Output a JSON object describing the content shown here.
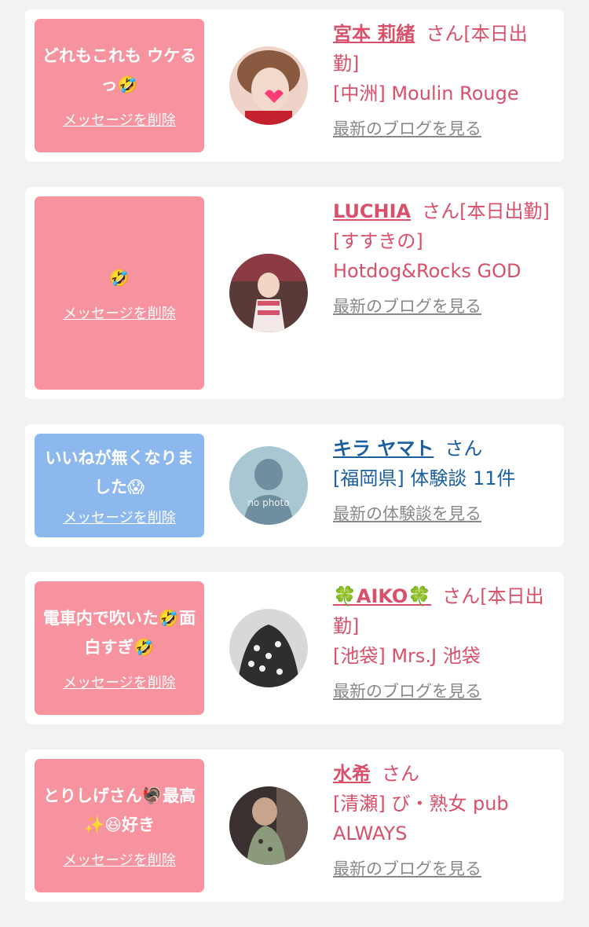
{
  "entries": [
    {
      "message": "どれもこれも ウケるっ🤣",
      "delete_label": "メッセージを削除",
      "name": "宮本 莉緒",
      "suffix": "さん[本日出勤]",
      "detail": "[中洲] Moulin Rouge",
      "link": "最新のブログを見る",
      "theme": "pink"
    },
    {
      "message": "🤣",
      "delete_label": "メッセージを削除",
      "name": "LUCHIA",
      "suffix": "さん[本日出勤]",
      "detail": "[すすきの] Hotdog&Rocks GOD",
      "link": "最新のブログを見る",
      "theme": "pink"
    },
    {
      "message": "いいねが無くなりました😱",
      "delete_label": "メッセージを削除",
      "name": "キラ ヤマト",
      "suffix": "さん",
      "detail": "[福岡県] 体験談 11件",
      "avatar_text": "no photo",
      "link": "最新の体験談を見る",
      "theme": "blue"
    },
    {
      "message": "電車内で吹いた🤣面白すぎ🤣",
      "delete_label": "メッセージを削除",
      "name": "🍀AIKO🍀",
      "suffix": "さん[本日出勤]",
      "detail": "[池袋] Mrs.J 池袋",
      "link": "最新のブログを見る",
      "theme": "pink"
    },
    {
      "message": "とりしげさん🦃最高✨😆好き",
      "delete_label": "メッセージを削除",
      "name": "水希",
      "suffix": "さん",
      "detail": "[清瀬] び・熟女 pub ALWAYS",
      "link": "最新のブログを見る",
      "theme": "pink"
    }
  ],
  "colors": {
    "pink_bubble": "#f7929f",
    "blue_bubble": "#8db8ee",
    "pink_text": "#d9506a",
    "blue_text": "#1a5fa0",
    "background": "#f2f2f4"
  }
}
